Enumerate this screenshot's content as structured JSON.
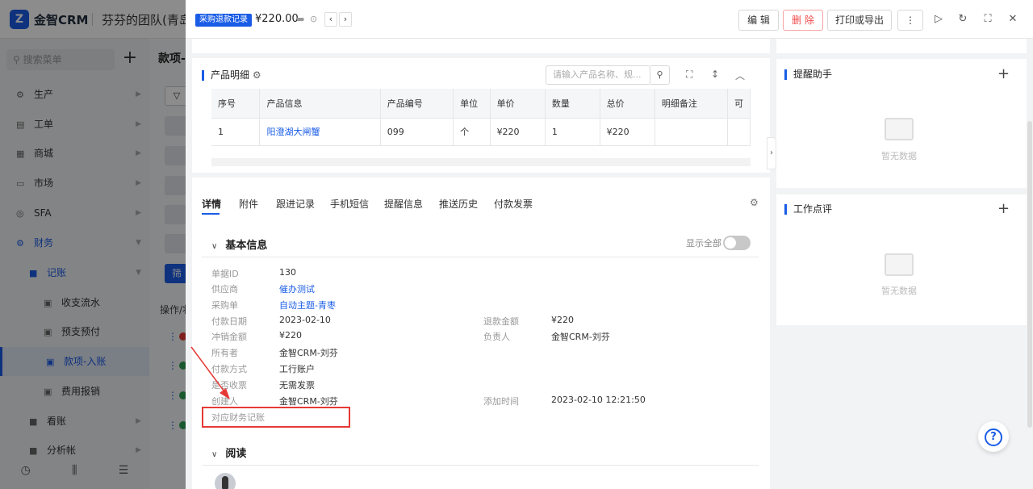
{
  "app": {
    "logo_text": "金智CRM",
    "team_name": "芬芬的团队(青岛"
  },
  "sidebar": {
    "search_placeholder": "搜索菜单",
    "add_label": "+",
    "items": [
      {
        "label": "生产",
        "icon": "cog-icon"
      },
      {
        "label": "工单",
        "icon": "doc-icon"
      },
      {
        "label": "商城",
        "icon": "shop-icon"
      },
      {
        "label": "市场",
        "icon": "calendar-icon"
      },
      {
        "label": "SFA",
        "icon": "sfa-icon"
      },
      {
        "label": "财务",
        "icon": "finance-icon"
      },
      {
        "label": "记账",
        "icon": "folder-icon"
      },
      {
        "label": "收支流水",
        "icon": "doc-icon"
      },
      {
        "label": "预支预付",
        "icon": "doc-icon"
      },
      {
        "label": "款项-入账",
        "icon": "doc-icon"
      },
      {
        "label": "费用报销",
        "icon": "doc-icon"
      },
      {
        "label": "看账",
        "icon": "folder-icon"
      },
      {
        "label": "分析帐",
        "icon": "folder-icon"
      }
    ]
  },
  "background": {
    "tab_title": "款项-入",
    "filter_button": "筛",
    "ops_label": "操作/状"
  },
  "drawer": {
    "badge": "采购退款记录",
    "amount": "¥220.00",
    "buttons": {
      "edit": "编 辑",
      "delete": "删 除",
      "print_export": "打印或导出"
    },
    "product_section": {
      "title": "产品明细",
      "search_placeholder": "请输入产品名称、规...",
      "columns": [
        "序号",
        "产品信息",
        "产品编号",
        "单位",
        "单价",
        "数量",
        "总价",
        "明细备注",
        "可"
      ],
      "rows": [
        [
          "1",
          "阳澄湖大闸蟹",
          "099",
          "个",
          "¥220",
          "1",
          "¥220",
          "",
          ""
        ]
      ]
    },
    "tabs": [
      "详情",
      "附件",
      "跟进记录",
      "手机短信",
      "提醒信息",
      "推送历史",
      "付款发票"
    ],
    "basic_info": {
      "title": "基本信息",
      "show_all": "显示全部",
      "fields": {
        "doc_id": {
          "label": "单据ID",
          "value": "130"
        },
        "supplier": {
          "label": "供应商",
          "value": "催办测试"
        },
        "purchase_order": {
          "label": "采购单",
          "value": "自动主题-青枣"
        },
        "pay_date": {
          "label": "付款日期",
          "value": "2023-02-10"
        },
        "refund_amount": {
          "label": "退款金额",
          "value": "¥220"
        },
        "offset_amount": {
          "label": "冲销金额",
          "value": "¥220"
        },
        "owner_person": {
          "label": "负责人",
          "value": "金智CRM-刘芬"
        },
        "owner": {
          "label": "所有者",
          "value": "金智CRM-刘芬"
        },
        "pay_method": {
          "label": "付款方式",
          "value": "工行账户"
        },
        "invoice_received": {
          "label": "是否收票",
          "value": "无需发票"
        },
        "creator": {
          "label": "创建人",
          "value": "金智CRM-刘芬"
        },
        "created_time": {
          "label": "添加时间",
          "value": "2023-02-10 12:21:50"
        },
        "finance_record": {
          "label": "对应财务记账",
          "value": ""
        }
      }
    },
    "read_section": {
      "title": "阅读"
    },
    "right_panels": {
      "reminder": {
        "title": "提醒助手",
        "empty": "暂无数据"
      },
      "review": {
        "title": "工作点评",
        "empty": "暂无数据"
      }
    }
  },
  "colors": {
    "accent": "#1a5ce6",
    "danger": "#f04848",
    "highlight": "#e53935"
  }
}
